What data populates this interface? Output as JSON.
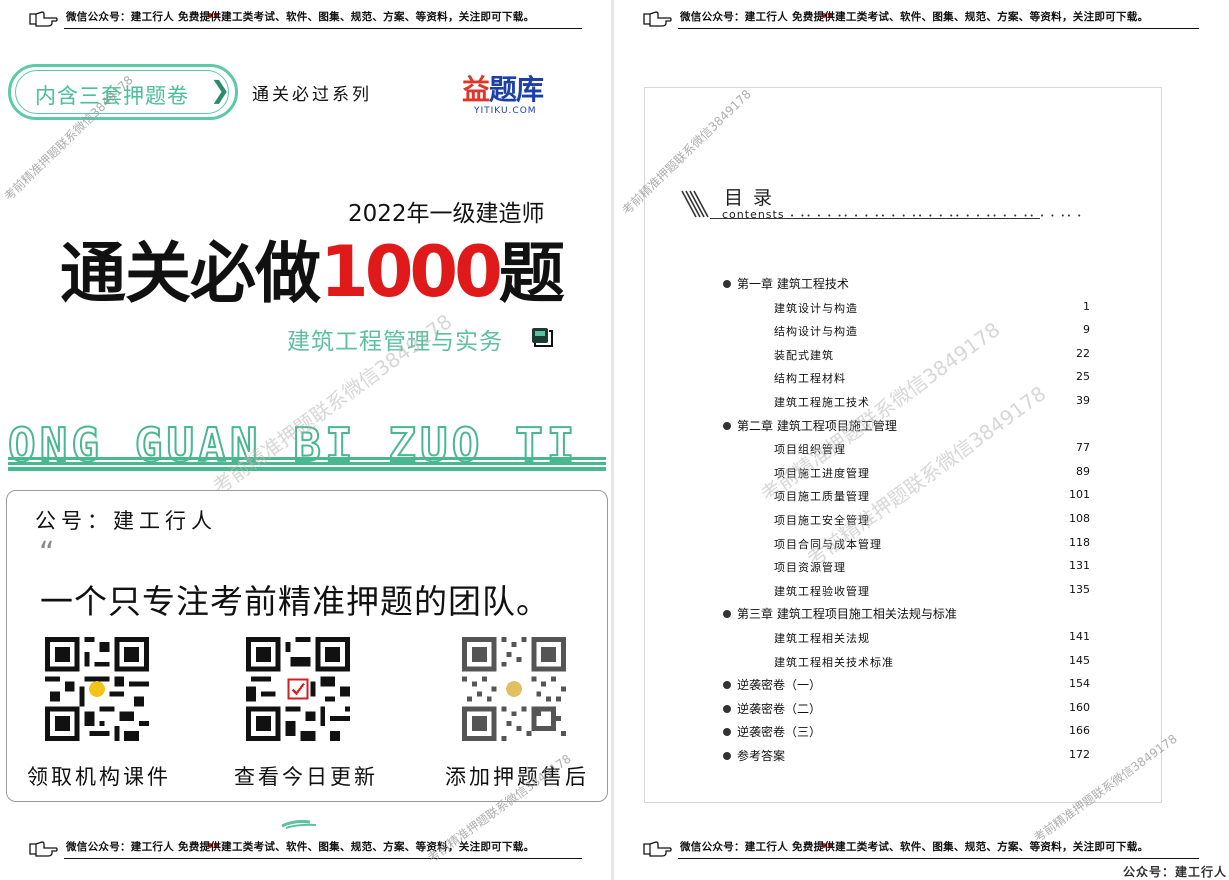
{
  "banner": {
    "text_before": "微信公众号：建工行人  ",
    "text_free": "免费",
    "text_after": "提供建工类考试、软件、图集、规范、方案、等资料，关注即可下载。"
  },
  "cover": {
    "pill_label": "内含三套押题卷",
    "pill_arrow": "❯",
    "series": "通关必过系列",
    "logo_cn_a": "益",
    "logo_cn_b": "题库",
    "logo_en": "YITIKU.COM",
    "year_line": "2022年一级建造师",
    "title_a": "通关必做",
    "title_num": "1000",
    "title_b": "题",
    "subject": "建筑工程管理与实务",
    "pinyin": "ONG GUAN BI ZUO TI",
    "watermark": "考前精准押题联系微信3849178"
  },
  "promo": {
    "account": "公号：建工行人",
    "quote_mark": "“",
    "slogan": "一个只专注考前精准押题的团队。",
    "qr_labels": [
      "领取机构课件",
      "查看今日更新",
      "添加押题售后"
    ]
  },
  "toc": {
    "title": "目 录",
    "subtitle": "contensts",
    "dots": "• •• •  • •• •  • •• •  • •• •  • •• •  • •• •  • •• •  • •• •",
    "rows": [
      {
        "type": "chapter",
        "label": "第一章   建筑工程技术",
        "page": ""
      },
      {
        "type": "section",
        "label": "建筑设计与构造",
        "page": "1"
      },
      {
        "type": "section",
        "label": "结构设计与构造",
        "page": "9"
      },
      {
        "type": "section",
        "label": "装配式建筑",
        "page": "22"
      },
      {
        "type": "section",
        "label": "结构工程材料",
        "page": "25"
      },
      {
        "type": "section",
        "label": "建筑工程施工技术",
        "page": "39"
      },
      {
        "type": "chapter",
        "label": "第二章   建筑工程项目施工管理",
        "page": ""
      },
      {
        "type": "section",
        "label": "项目组织管理",
        "page": "77"
      },
      {
        "type": "section",
        "label": "项目施工进度管理",
        "page": "89"
      },
      {
        "type": "section",
        "label": "项目施工质量管理",
        "page": "101"
      },
      {
        "type": "section",
        "label": "项目施工安全管理",
        "page": "108"
      },
      {
        "type": "section",
        "label": "项目合同与成本管理",
        "page": "118"
      },
      {
        "type": "section",
        "label": "项目资源管理",
        "page": "131"
      },
      {
        "type": "section",
        "label": "建筑工程验收管理",
        "page": "135"
      },
      {
        "type": "chapter",
        "label": "第三章   建筑工程项目施工相关法规与标准",
        "page": ""
      },
      {
        "type": "section",
        "label": "建筑工程相关法规",
        "page": "141"
      },
      {
        "type": "section",
        "label": "建筑工程相关技术标准",
        "page": "145"
      },
      {
        "type": "chapter",
        "label": "逆袭密卷（一）",
        "page": "154"
      },
      {
        "type": "chapter",
        "label": "逆袭密卷（二）",
        "page": "160"
      },
      {
        "type": "chapter",
        "label": "逆袭密卷（三）",
        "page": "166"
      },
      {
        "type": "chapter",
        "label": "参考答案",
        "page": "172"
      }
    ]
  },
  "bottom_caption": "公众号：建工行人",
  "colors": {
    "accent_green": "#4abf9a",
    "title_red": "#e01a1a",
    "logo_blue": "#1c3fa8"
  },
  "icons": [
    "pointing-hand-icon",
    "chevron-right-icon",
    "book-icon",
    "qr-code-icon"
  ]
}
